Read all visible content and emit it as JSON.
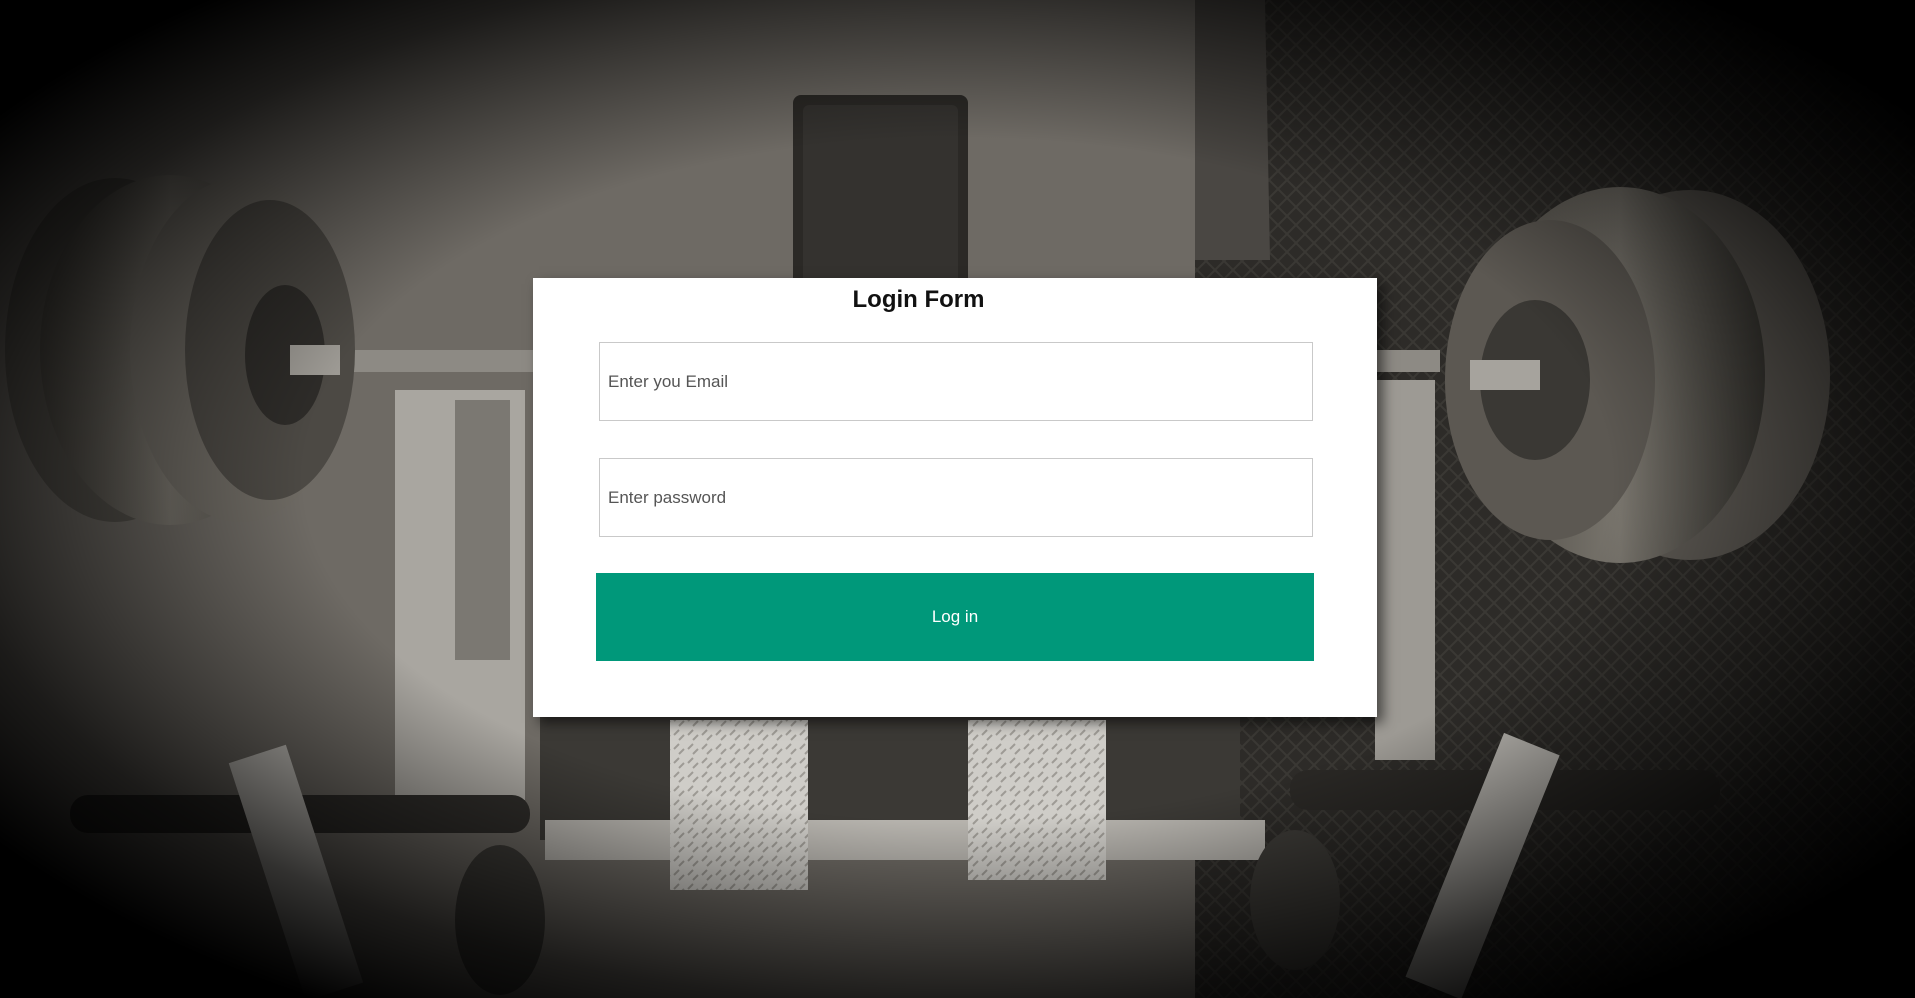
{
  "form": {
    "title": "Login Form",
    "email_placeholder": "Enter you Email",
    "email_value": "",
    "password_placeholder": "Enter password",
    "password_value": "",
    "login_label": "Log in"
  },
  "colors": {
    "button_bg": "#00987a",
    "button_text": "#ffffff",
    "card_bg": "#ffffff",
    "title_text": "#111111"
  },
  "background": {
    "image_subject": "gym-barbell-bench-photo"
  }
}
